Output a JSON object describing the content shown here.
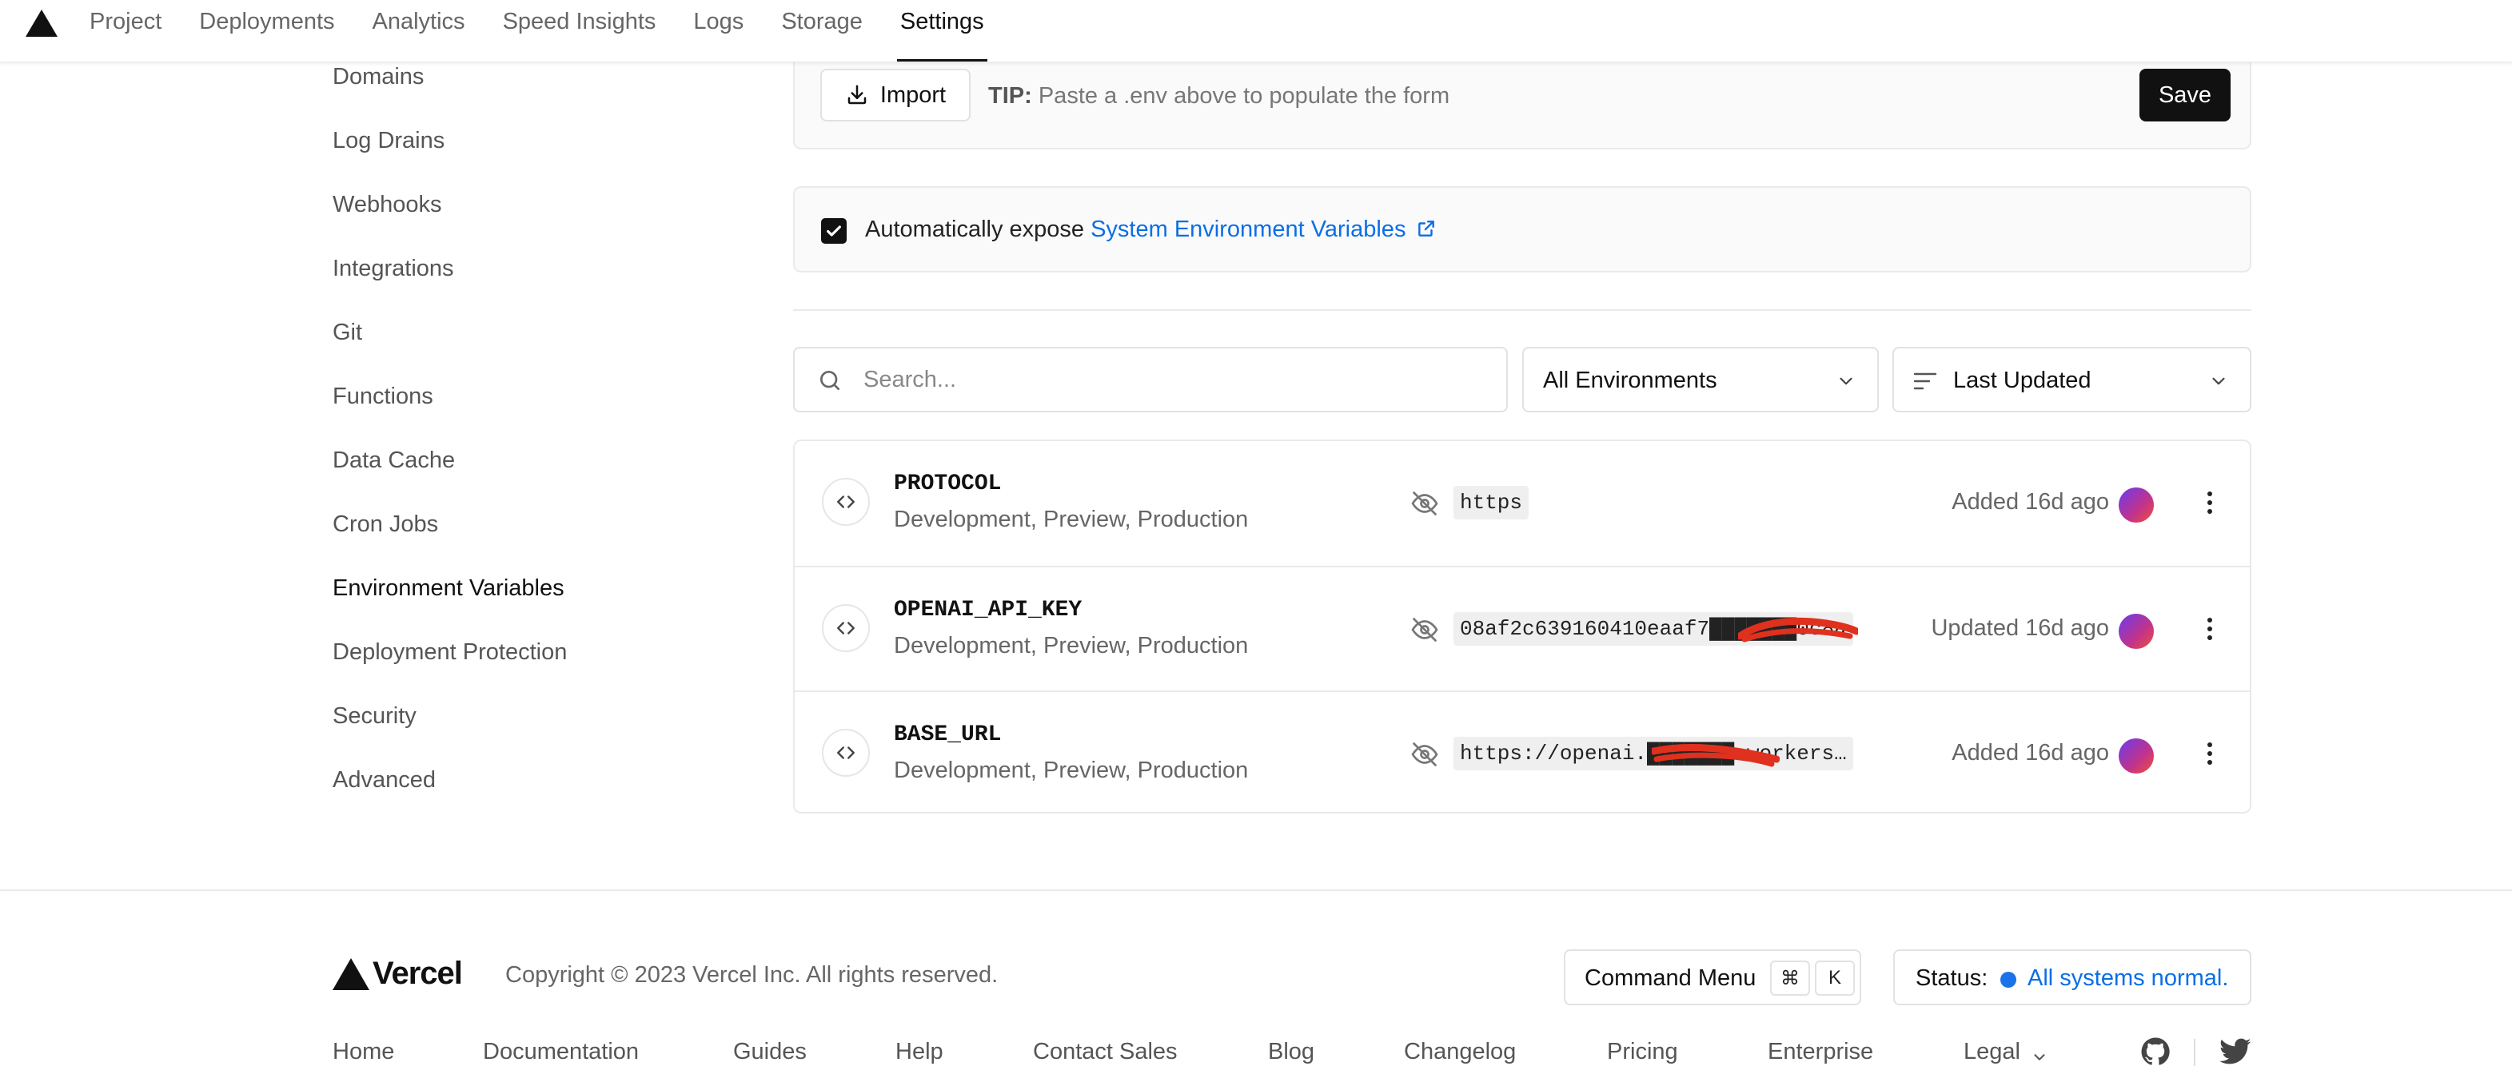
{
  "nav": {
    "tabs": [
      "Project",
      "Deployments",
      "Analytics",
      "Speed Insights",
      "Logs",
      "Storage",
      "Settings"
    ],
    "active_tab": "Settings"
  },
  "sidebar": {
    "items": [
      "Domains",
      "Log Drains",
      "Webhooks",
      "Integrations",
      "Git",
      "Functions",
      "Data Cache",
      "Cron Jobs",
      "Environment Variables",
      "Deployment Protection",
      "Security",
      "Advanced"
    ],
    "active": "Environment Variables"
  },
  "import_bar": {
    "import_label": "Import",
    "tip_label": "TIP:",
    "tip_text": "Paste a .env above to populate the form",
    "save_label": "Save"
  },
  "expose": {
    "checked": true,
    "text": "Automatically expose",
    "link": "System Environment Variables"
  },
  "filters": {
    "search_placeholder": "Search...",
    "environment": "All Environments",
    "sort": "Last Updated"
  },
  "env_vars": [
    {
      "name": "PROTOCOL",
      "targets": "Development, Preview, Production",
      "value": "https",
      "updated": "Added 16d ago"
    },
    {
      "name": "OPENAI_API_KEY",
      "targets": "Development, Preview, Production",
      "value": "08af2c639160410eaaf7███████0c8a",
      "updated": "Updated 16d ago"
    },
    {
      "name": "BASE_URL",
      "targets": "Development, Preview, Production",
      "value": "https://openai.███████.workers…",
      "updated": "Added 16d ago"
    }
  ],
  "footer": {
    "brand": "Vercel",
    "copyright": "Copyright © 2023 Vercel Inc. All rights reserved.",
    "command_menu": "Command Menu",
    "shortcut_keys": [
      "⌘",
      "K"
    ],
    "status_label": "Status:",
    "status_text": "All systems normal.",
    "links": [
      "Home",
      "Documentation",
      "Guides",
      "Help",
      "Contact Sales",
      "Blog",
      "Changelog",
      "Pricing",
      "Enterprise",
      "Legal"
    ]
  },
  "colors": {
    "accent_link": "#0a6ee6",
    "primary_button": "#111111",
    "status_dot": "#1a73e8",
    "redaction": "#e0301e"
  }
}
